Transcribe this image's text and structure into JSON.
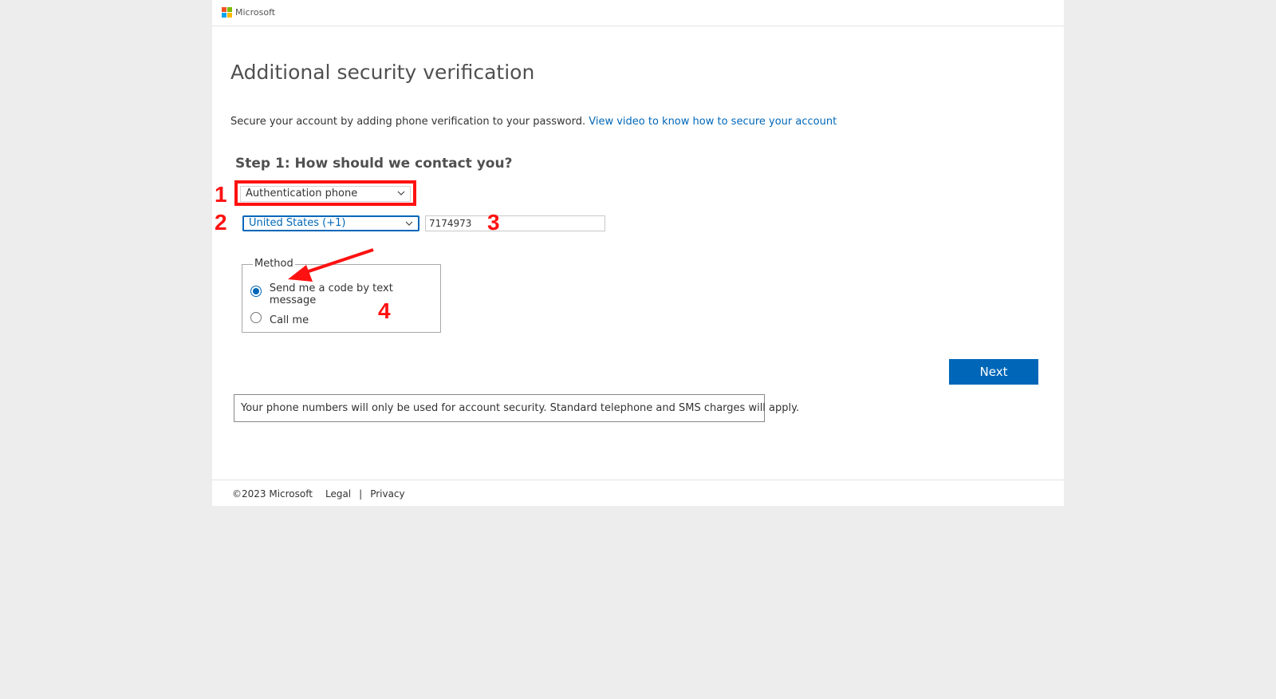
{
  "header": {
    "brand": "Microsoft",
    "logo_colors": [
      "#f25022",
      "#7fba00",
      "#00a4ef",
      "#ffb900"
    ]
  },
  "main": {
    "title": "Additional security verification",
    "intro_text": "Secure your account by adding phone verification to your password.",
    "intro_link": "View video to know how to secure your account",
    "step_heading": "Step 1: How should we contact you?",
    "contact_select": {
      "value": "Authentication phone"
    },
    "country_select": {
      "value": "United States (+1)"
    },
    "phone_input": {
      "value": "7174973"
    },
    "method": {
      "legend": "Method",
      "options": [
        {
          "label": "Send me a code by text message",
          "selected": true
        },
        {
          "label": "Call me",
          "selected": false
        }
      ]
    },
    "next_label": "Next",
    "notice": "Your phone numbers will only be used for account security. Standard telephone and SMS charges will apply."
  },
  "annotations": {
    "n1": "1",
    "n2": "2",
    "n3": "3",
    "n4": "4",
    "color": "#ff1111"
  },
  "footer": {
    "copyright": "©2023 Microsoft",
    "legal": "Legal",
    "separator": "|",
    "privacy": "Privacy"
  },
  "colors": {
    "accent": "#0067b8",
    "background": "#ededed"
  }
}
